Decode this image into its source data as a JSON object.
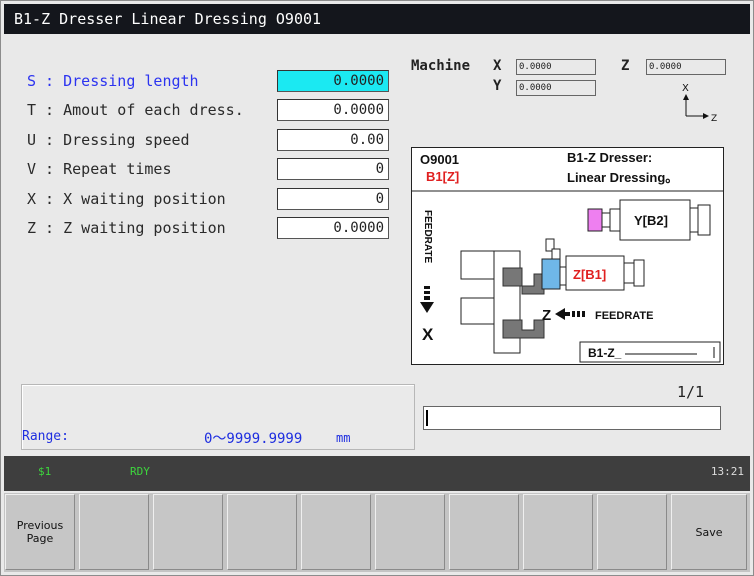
{
  "window": {
    "title": "B1-Z Dresser Linear Dressing O9001"
  },
  "params": [
    {
      "label": "S : Dressing length",
      "value": "0.0000",
      "active": true
    },
    {
      "label": "T : Amout of each dress.",
      "value": "0.0000",
      "active": false
    },
    {
      "label": "U : Dressing speed",
      "value": "0.00",
      "active": false
    },
    {
      "label": "V : Repeat times",
      "value": "0",
      "active": false
    },
    {
      "label": "X : X waiting position",
      "value": "0",
      "active": false
    },
    {
      "label": "Z : Z waiting position",
      "value": "0.0000",
      "active": false
    }
  ],
  "machine": {
    "label": "Machine",
    "x_label": "X",
    "x_value": "0.0000",
    "z_label": "Z",
    "z_value": "0.0000",
    "y_label": "Y",
    "y_value": "0.0000",
    "axis_x": "X",
    "axis_z": "Z"
  },
  "diagram": {
    "program": "O9001",
    "left_axis": "B1[Z]",
    "head_line1": "B1-Z Dresser:",
    "head_line2": "Linear Dressing。",
    "feedrate_vertical": "FEEDRATE",
    "x_arrow_label": "X",
    "z_feed_label": "Z",
    "z_feedrate": "FEEDRATE",
    "y_spindle": "Y[B2]",
    "z_spindle": "Z[B1]",
    "footer": "B1-Z_"
  },
  "range": {
    "label": "Range:",
    "value": "0～9999.9999",
    "unit": "mm"
  },
  "page_indicator": "1/1",
  "input_value": "",
  "status": {
    "channel": "$1",
    "state": "RDY",
    "time": "13:21"
  },
  "fkeys": [
    "Previous\nPage",
    "",
    "",
    "",
    "",
    "",
    "",
    "",
    "",
    "Save"
  ],
  "colors": {
    "active_field": "#1be9f2",
    "active_label": "#2c34f0",
    "range_text": "#1e2ee0",
    "status_text": "#3dd63d",
    "z_spindle": "#e02020",
    "b1z": "#e02020"
  }
}
